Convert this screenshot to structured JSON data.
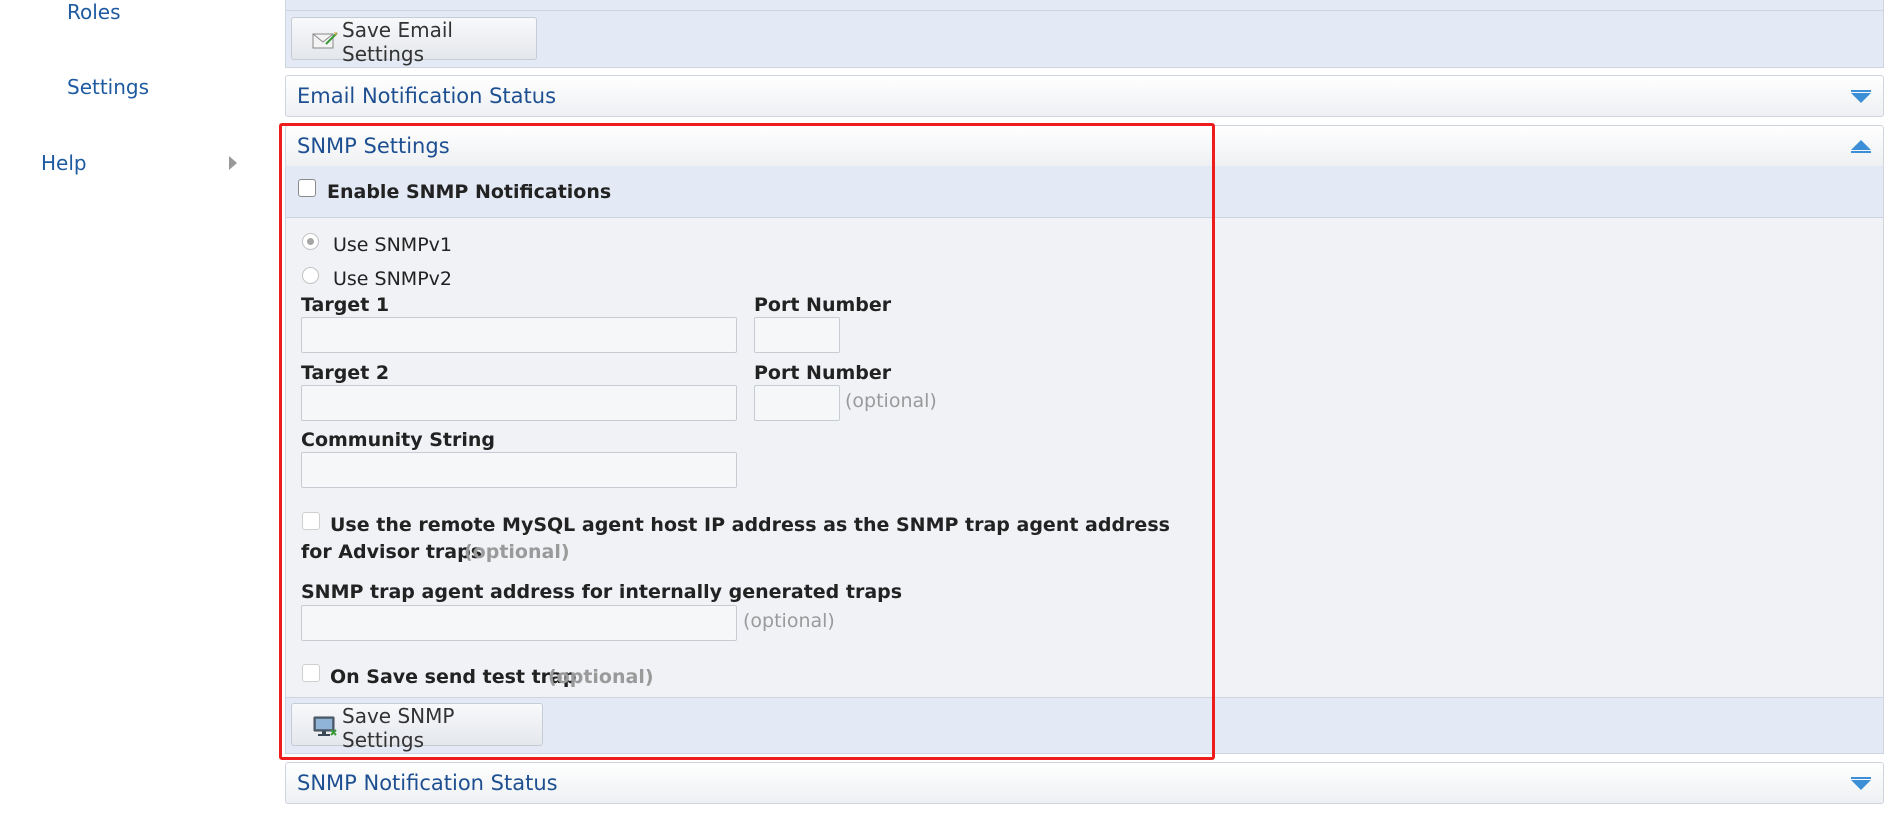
{
  "sidebar": {
    "items": [
      {
        "label": "Roles"
      },
      {
        "label": "Settings"
      },
      {
        "label": "Help"
      }
    ]
  },
  "email_panel": {
    "save_button_label": "Save Email Settings"
  },
  "email_status_panel": {
    "title": "Email Notification Status"
  },
  "snmp_panel": {
    "title": "SNMP Settings",
    "enable_label": "Enable SNMP Notifications",
    "version_v1_label": "Use SNMPv1",
    "version_v2_label": "Use SNMPv2",
    "selected_version": "v1",
    "target1_label": "Target 1",
    "target1_value": "",
    "port1_label": "Port Number",
    "port1_value": "",
    "target2_label": "Target 2",
    "target2_value": "",
    "port2_label": "Port Number",
    "port2_value": "",
    "port2_hint": "(optional)",
    "community_label": "Community String",
    "community_value": "",
    "remote_agent_label_line1": "Use the remote MySQL agent host IP address as the SNMP trap agent address",
    "remote_agent_label_line2": "for Advisor traps",
    "remote_agent_hint": "(optional)",
    "trap_agent_label": "SNMP trap agent address for internally generated traps",
    "trap_agent_value": "",
    "trap_agent_hint": "(optional)",
    "test_trap_label": "On Save send test trap",
    "test_trap_hint": "(optional)",
    "save_button_label": "Save SNMP Settings"
  },
  "snmp_status_panel": {
    "title": "SNMP Notification Status"
  },
  "colors": {
    "link": "#1e5aa0",
    "panel_title": "#1d4f91",
    "highlight_border": "#ee1c1c",
    "section_band": "#e3eaf5",
    "toggle_arrow": "#3c8fd6"
  }
}
